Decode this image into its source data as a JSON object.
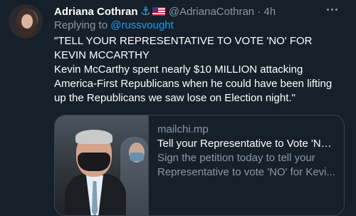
{
  "tweet": {
    "display_name": "Adriana Cothran",
    "handle_time": "@AdrianaCothran · 4h",
    "replying_prefix": "Replying to",
    "replying_to": "@russvought",
    "text_lines": [
      "\"TELL YOUR REPRESENTATIVE TO VOTE 'NO' FOR KEVIN MCCARTHY",
      "Kevin McCarthy spent nearly $10 MILLION attacking America-First Republicans when he could have been lifting up the Republicans we saw lose on Election night.\""
    ],
    "name_emojis": [
      "anchor-icon",
      "us-flag-icon"
    ]
  },
  "card": {
    "domain": "mailchi.mp",
    "title": "Tell your Representative to Vote 'NO...",
    "description_line1": "Sign the petition today to tell your",
    "description_line2": "Representative to vote 'NO' for Kevi..."
  },
  "colors": {
    "background": "#15202b",
    "link": "#1d9bf0",
    "secondary_text": "#8b98a5",
    "border": "#38444d"
  }
}
